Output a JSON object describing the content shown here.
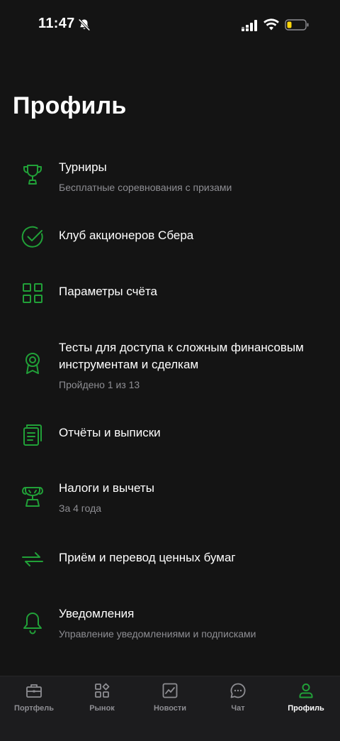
{
  "status_bar": {
    "time": "11:47"
  },
  "colors": {
    "accent": "#21A038",
    "background": "#141414",
    "tabbar": "#1C1C1E",
    "secondary_text": "#8E8E93"
  },
  "page_title": "Профиль",
  "menu": [
    {
      "icon": "trophy-icon",
      "title": "Турниры",
      "subtitle": "Бесплатные соревнования с призами"
    },
    {
      "icon": "checkmark-circle-icon",
      "title": "Клуб акционеров Сбера",
      "subtitle": ""
    },
    {
      "icon": "grid-icon",
      "title": "Параметры счёта",
      "subtitle": ""
    },
    {
      "icon": "badge-icon",
      "title": "Тесты для доступа к сложным финансовым\nинструментам и сделкам",
      "subtitle": "Пройдено 1 из 13"
    },
    {
      "icon": "documents-icon",
      "title": "Отчёты и выписки",
      "subtitle": ""
    },
    {
      "icon": "taxes-icon",
      "title": "Налоги и вычеты",
      "subtitle": "За 4 года"
    },
    {
      "icon": "transfer-arrows-icon",
      "title": "Приём и перевод ценных бумаг",
      "subtitle": ""
    },
    {
      "icon": "bell-icon",
      "title": "Уведомления",
      "subtitle": "Управление уведомлениями и подписками"
    }
  ],
  "tabs": [
    {
      "icon": "briefcase-icon",
      "label": "Портфель",
      "active": false
    },
    {
      "icon": "market-icon",
      "label": "Рынок",
      "active": false
    },
    {
      "icon": "news-chart-icon",
      "label": "Новости",
      "active": false
    },
    {
      "icon": "chat-icon",
      "label": "Чат",
      "active": false
    },
    {
      "icon": "profile-icon",
      "label": "Профиль",
      "active": true
    }
  ]
}
